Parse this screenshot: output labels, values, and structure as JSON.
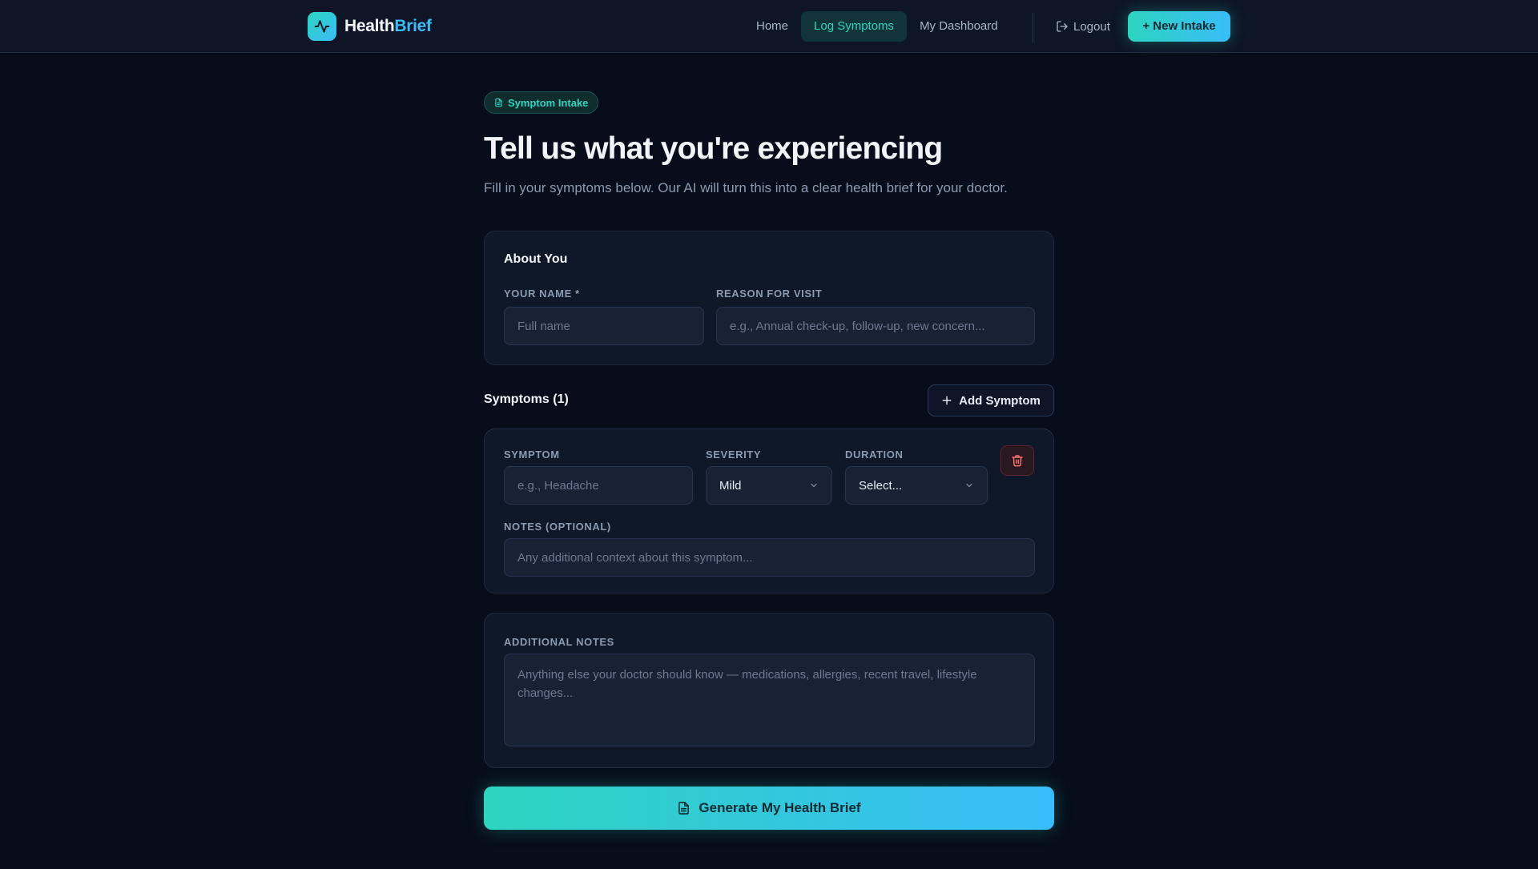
{
  "header": {
    "brand_part1": "Health",
    "brand_part2": "Brief",
    "nav": [
      {
        "label": "Home",
        "active": false
      },
      {
        "label": "Log Symptoms",
        "active": true
      },
      {
        "label": "My Dashboard",
        "active": false
      }
    ],
    "logout_label": "Logout",
    "new_intake_label": "+ New Intake"
  },
  "page": {
    "tag": "Symptom Intake",
    "title": "Tell us what you're experiencing",
    "subtitle": "Fill in your symptoms below. Our AI will turn this into a clear health brief for your doctor."
  },
  "about": {
    "title": "About You",
    "name_label": "Your Name *",
    "name_placeholder": "Full name",
    "reason_label": "Reason for Visit",
    "reason_placeholder": "e.g., Annual check-up, follow-up, new concern..."
  },
  "symptoms": {
    "title": "Symptoms (1)",
    "add_label": "Add Symptom",
    "items": [
      {
        "symptom_label": "Symptom",
        "symptom_placeholder": "e.g., Headache",
        "severity_label": "Severity",
        "severity_value": "Mild",
        "duration_label": "Duration",
        "duration_value": "Select...",
        "notes_label": "Notes (Optional)",
        "notes_placeholder": "Any additional context about this symptom..."
      }
    ]
  },
  "additional": {
    "label": "Additional Notes",
    "placeholder": "Anything else your doctor should know — medications, allergies, recent travel, lifestyle changes..."
  },
  "generate_label": "Generate My Health Brief",
  "colors": {
    "accent": "#2dd4bf",
    "accent2": "#38bdf8",
    "background": "#070d1a",
    "danger": "#f87171"
  }
}
